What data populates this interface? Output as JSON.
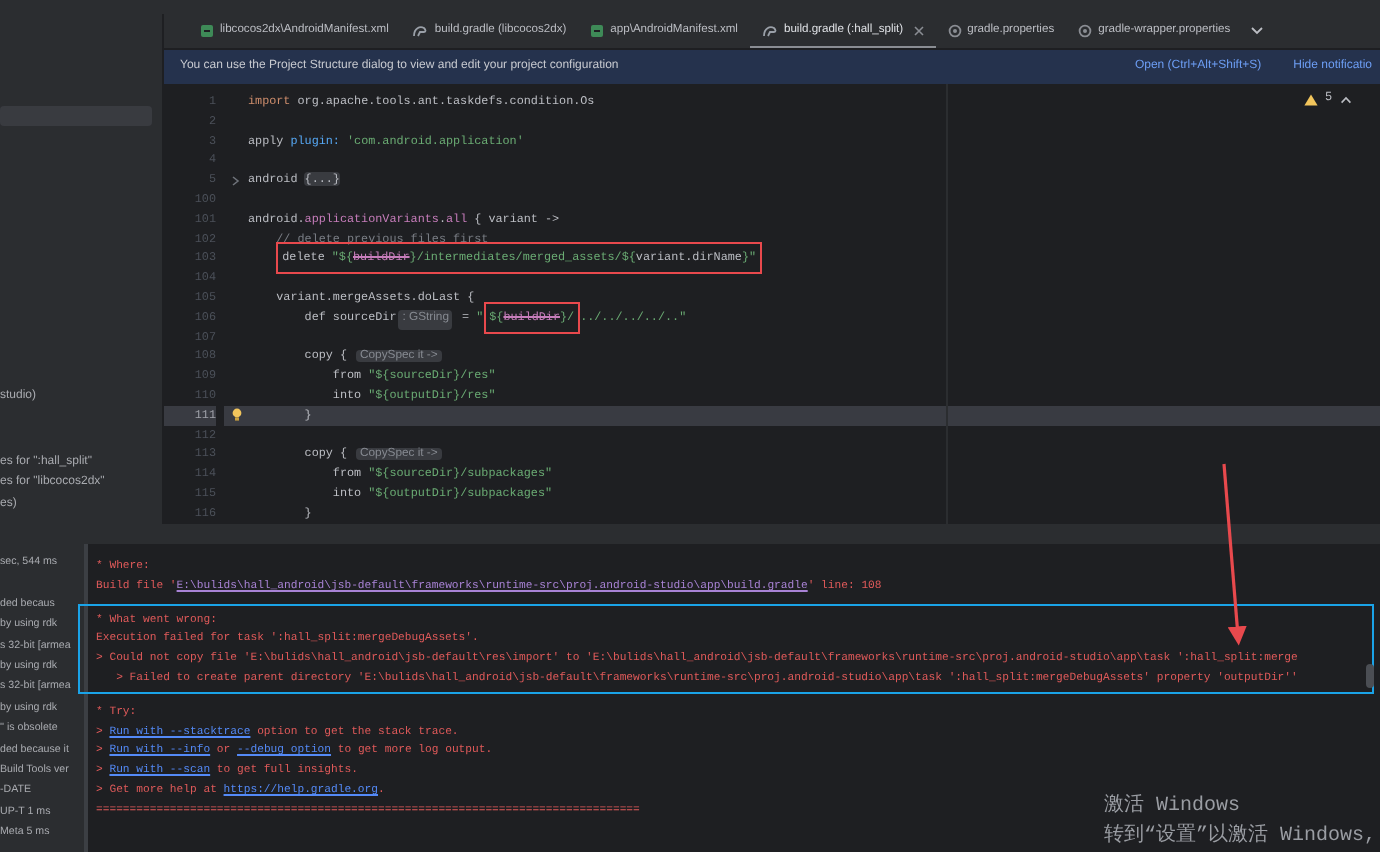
{
  "tabs": [
    {
      "label": "libcocos2dx\\AndroidManifest.xml",
      "kind": "xml",
      "selected": false
    },
    {
      "label": "build.gradle (libcocos2dx)",
      "kind": "gradle",
      "selected": false
    },
    {
      "label": "app\\AndroidManifest.xml",
      "kind": "xml",
      "selected": false
    },
    {
      "label": "build.gradle (:hall_split)",
      "kind": "gradle",
      "selected": true
    },
    {
      "label": "gradle.properties",
      "kind": "props",
      "selected": false
    },
    {
      "label": "gradle-wrapper.properties",
      "kind": "props",
      "selected": false
    }
  ],
  "notification": {
    "message": "You can use the Project Structure dialog to view and edit your project configuration",
    "actions": [
      "Open (Ctrl+Alt+Shift+S)",
      "Hide notificatio"
    ]
  },
  "project_panel": {
    "items": [
      "studio)",
      "es for \":hall_split\"",
      "es for \"libcocos2dx\"",
      "es)"
    ]
  },
  "editor": {
    "problems": "5",
    "lines": [
      {
        "num": "1",
        "current": false,
        "tokens": [
          {
            "kind": "keyword",
            "t": "import"
          },
          {
            "kind": "plain",
            "t": " org.apache.tools.ant.taskdefs.condition.Os"
          }
        ]
      },
      {
        "num": "2",
        "current": false
      },
      {
        "num": "3",
        "current": false,
        "tokens": [
          {
            "kind": "plain",
            "t": "apply "
          },
          {
            "kind": "param",
            "t": "plugin:"
          },
          {
            "kind": "string",
            "t": " 'com.android.application'"
          }
        ]
      },
      {
        "num": "4",
        "current": false
      },
      {
        "num": "5",
        "current": false,
        "fold": true,
        "tokens": [
          {
            "kind": "plain",
            "t": "android "
          },
          {
            "kind": "folded",
            "t": "{...}"
          }
        ]
      },
      {
        "num": "100",
        "current": false
      },
      {
        "num": "101",
        "current": false,
        "tokens": [
          {
            "kind": "plain",
            "t": "android."
          },
          {
            "kind": "property",
            "t": "applicationVariants"
          },
          {
            "kind": "plain",
            "t": "."
          },
          {
            "kind": "property",
            "t": "all"
          },
          {
            "kind": "plain",
            "t": " { variant ->"
          }
        ]
      },
      {
        "num": "102",
        "current": false,
        "tokens": [
          {
            "kind": "comment",
            "t": "    // delete previous files first"
          }
        ]
      },
      {
        "num": "103",
        "current": false,
        "tokens": [
          {
            "kind": "annotation",
            "tokens": [
              {
                "kind": "plain",
                "t": "delete "
              },
              {
                "kind": "string",
                "t": "\"${"
              },
              {
                "kind": "deprecated",
                "t": "buildDir"
              },
              {
                "kind": "string",
                "t": "}/intermediates/merged_assets/${"
              },
              {
                "kind": "plain",
                "t": "variant.dirName"
              },
              {
                "kind": "string",
                "t": "}\""
              }
            ]
          }
        ]
      },
      {
        "num": "104",
        "current": false
      },
      {
        "num": "105",
        "current": false,
        "tokens": [
          {
            "kind": "plain",
            "t": "    variant.mergeAssets.doLast {"
          }
        ]
      },
      {
        "num": "106",
        "current": false,
        "tokens": [
          {
            "kind": "plain",
            "t": "        def sourceDir"
          },
          {
            "kind": "hint",
            "t": ": GString"
          },
          {
            "kind": "plain",
            "t": " = "
          },
          {
            "kind": "string",
            "t": "\""
          },
          {
            "kind": "annotation",
            "tokens": [
              {
                "kind": "string",
                "t": "${"
              },
              {
                "kind": "deprecated",
                "t": "buildDir"
              },
              {
                "kind": "string",
                "t": "}/"
              }
            ]
          },
          {
            "kind": "string",
            "t": "../../../../..\""
          }
        ]
      },
      {
        "num": "107",
        "current": false
      },
      {
        "num": "108",
        "current": false,
        "tokens": [
          {
            "kind": "plain",
            "t": "        copy { "
          },
          {
            "kind": "hint",
            "t": "CopySpec it ->"
          }
        ]
      },
      {
        "num": "109",
        "current": false,
        "tokens": [
          {
            "kind": "plain",
            "t": "            from "
          },
          {
            "kind": "string",
            "t": "\"${sourceDir}/res\""
          }
        ]
      },
      {
        "num": "110",
        "current": false,
        "tokens": [
          {
            "kind": "plain",
            "t": "            into "
          },
          {
            "kind": "string",
            "t": "\"${outputDir}/res\""
          }
        ]
      },
      {
        "num": "111",
        "current": true,
        "bulb": true,
        "tokens": [
          {
            "kind": "plain",
            "t": "        }"
          }
        ]
      },
      {
        "num": "112",
        "current": false
      },
      {
        "num": "113",
        "current": false,
        "tokens": [
          {
            "kind": "plain",
            "t": "        copy { "
          },
          {
            "kind": "hint",
            "t": "CopySpec it ->"
          }
        ]
      },
      {
        "num": "114",
        "current": false,
        "tokens": [
          {
            "kind": "plain",
            "t": "            from "
          },
          {
            "kind": "string",
            "t": "\"${sourceDir}/subpackages\""
          }
        ]
      },
      {
        "num": "115",
        "current": false,
        "tokens": [
          {
            "kind": "plain",
            "t": "            into "
          },
          {
            "kind": "string",
            "t": "\"${outputDir}/subpackages\""
          }
        ]
      },
      {
        "num": "116",
        "current": false,
        "tokens": [
          {
            "kind": "plain",
            "t": "        }"
          }
        ]
      }
    ]
  },
  "build_tree": [
    "sec, 544 ms",
    "ded becaus",
    "by using rdk",
    "s 32-bit [armea",
    "by using rdk",
    "s 32-bit [armea",
    "by using rdk",
    "'' is obsolete",
    "ded because it",
    "Build Tools ver",
    "-DATE",
    "UP-T 1 ms",
    "Meta 5 ms"
  ],
  "console": {
    "blocks": [
      {
        "boxed": false,
        "lines": [
          [
            {
              "kind": "text",
              "t": "* Where:"
            }
          ],
          [
            {
              "kind": "text",
              "t": "Build file '"
            },
            {
              "kind": "file-link",
              "t": "E:\\bulids\\hall_android\\jsb-default\\frameworks\\runtime-src\\proj.android-studio\\app\\build.gradle"
            },
            {
              "kind": "text",
              "t": "' line: 108"
            }
          ]
        ]
      },
      {
        "boxed": true,
        "lines": [
          [
            {
              "kind": "text",
              "t": "* What went wrong:"
            }
          ],
          [
            {
              "kind": "text",
              "t": "Execution failed for task ':hall_split:mergeDebugAssets'."
            }
          ],
          [
            {
              "kind": "text",
              "t": "> Could not copy file 'E:\\bulids\\hall_android\\jsb-default\\res\\import' to 'E:\\bulids\\hall_android\\jsb-default\\frameworks\\runtime-src\\proj.android-studio\\app\\task ':hall_split:merge"
            }
          ],
          [
            {
              "kind": "text",
              "t": "   > Failed to create parent directory 'E:\\bulids\\hall_android\\jsb-default\\frameworks\\runtime-src\\proj.android-studio\\app\\task ':hall_split:mergeDebugAssets' property 'outputDir''"
            }
          ]
        ]
      },
      {
        "boxed": false,
        "lines": [
          [
            {
              "kind": "text",
              "t": "* Try:"
            }
          ],
          [
            {
              "kind": "text",
              "t": "> "
            },
            {
              "kind": "link",
              "t": "Run with --stacktrace"
            },
            {
              "kind": "text",
              "t": " option to get the stack trace."
            }
          ],
          [
            {
              "kind": "text",
              "t": "> "
            },
            {
              "kind": "link",
              "t": "Run with --info"
            },
            {
              "kind": "text",
              "t": " or "
            },
            {
              "kind": "link",
              "t": "--debug option"
            },
            {
              "kind": "text",
              "t": " to get more log output."
            }
          ],
          [
            {
              "kind": "text",
              "t": "> "
            },
            {
              "kind": "link",
              "t": "Run with --scan"
            },
            {
              "kind": "text",
              "t": " to get full insights."
            }
          ],
          [
            {
              "kind": "text",
              "t": "> Get more help at "
            },
            {
              "kind": "link",
              "t": "https://help.gradle.org"
            },
            {
              "kind": "text",
              "t": "."
            }
          ],
          [
            {
              "kind": "text",
              "t": "================================================================================="
            }
          ]
        ]
      }
    ]
  },
  "os_notice": {
    "title": "激活 Windows",
    "subtitle": "转到“设置”以激活 Windows,"
  }
}
